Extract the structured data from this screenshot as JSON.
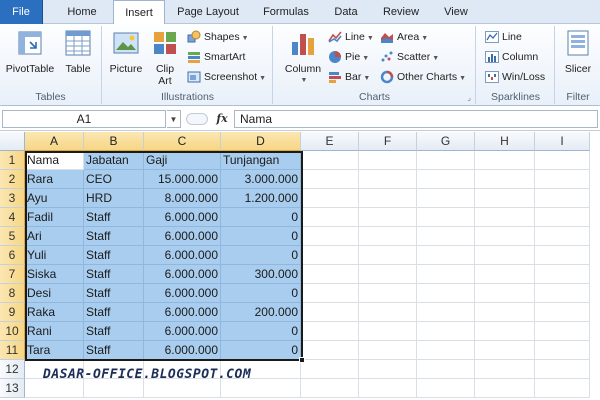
{
  "tabs": [
    {
      "label": "File"
    },
    {
      "label": "Home"
    },
    {
      "label": "Insert"
    },
    {
      "label": "Page Layout"
    },
    {
      "label": "Formulas"
    },
    {
      "label": "Data"
    },
    {
      "label": "Review"
    },
    {
      "label": "View"
    }
  ],
  "active_tab": "Insert",
  "ribbon": {
    "tables": {
      "label": "Tables",
      "pivottable": "PivotTable",
      "table": "Table"
    },
    "illustrations": {
      "label": "Illustrations",
      "picture": "Picture",
      "clipart_line1": "Clip",
      "clipart_line2": "Art",
      "shapes": "Shapes",
      "smartart": "SmartArt",
      "screenshot": "Screenshot"
    },
    "charts": {
      "label": "Charts",
      "column": "Column",
      "line": "Line",
      "pie": "Pie",
      "bar": "Bar",
      "area": "Area",
      "scatter": "Scatter",
      "other": "Other Charts"
    },
    "sparklines": {
      "label": "Sparklines",
      "line": "Line",
      "column": "Column",
      "winloss": "Win/Loss"
    },
    "filter": {
      "label": "Filter",
      "slicer": "Slicer"
    }
  },
  "formula_bar": {
    "name_box": "A1",
    "fx": "fx",
    "content": "Nama"
  },
  "sheet": {
    "columns": [
      "A",
      "B",
      "C",
      "D",
      "E",
      "F",
      "G",
      "H",
      "I"
    ],
    "rows": [
      [
        "Nama",
        "Jabatan",
        "Gaji",
        "Tunjangan"
      ],
      [
        "Rara",
        "CEO",
        "15.000.000",
        "3.000.000"
      ],
      [
        "Ayu",
        "HRD",
        "8.000.000",
        "1.200.000"
      ],
      [
        "Fadil",
        "Staff",
        "6.000.000",
        "0"
      ],
      [
        "Ari",
        "Staff",
        "6.000.000",
        "0"
      ],
      [
        "Yuli",
        "Staff",
        "6.000.000",
        "0"
      ],
      [
        "Siska",
        "Staff",
        "6.000.000",
        "300.000"
      ],
      [
        "Desi",
        "Staff",
        "6.000.000",
        "0"
      ],
      [
        "Raka",
        "Staff",
        "6.000.000",
        "200.000"
      ],
      [
        "Rani",
        "Staff",
        "6.000.000",
        "0"
      ],
      [
        "Tara",
        "Staff",
        "6.000.000",
        "0"
      ],
      [
        "",
        "",
        "",
        ""
      ],
      [
        "",
        "",
        "",
        ""
      ]
    ],
    "row_numbers": [
      "1",
      "2",
      "3",
      "4",
      "5",
      "6",
      "7",
      "8",
      "9",
      "10",
      "11",
      "12",
      "13"
    ]
  },
  "watermark": "DASAR-OFFICE.BLOGSPOT.COM",
  "colors": {
    "file_tab": "#2a6fc0",
    "selection_fill": "#a8cdef",
    "header_selected": "#f7d684"
  }
}
